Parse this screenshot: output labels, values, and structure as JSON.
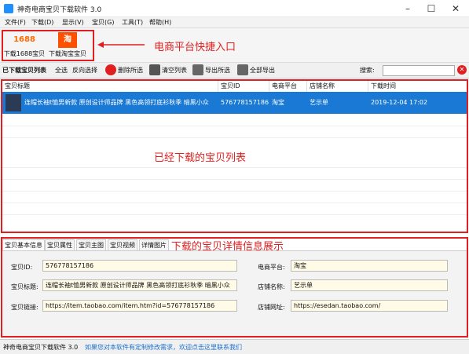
{
  "window": {
    "title": "神奇电商宝贝下载软件 3.0"
  },
  "menu": [
    "文件(F)",
    "下载(D)",
    "显示(V)",
    "宝贝(G)",
    "工具(T)",
    "帮助(H)"
  ],
  "platforms": [
    {
      "logo": "1688",
      "label": "下载1688宝贝",
      "color": "#ff6a00"
    },
    {
      "logo": "淘",
      "label": "下载淘宝宝贝",
      "color": "#ff5000"
    }
  ],
  "annotations": {
    "platform": "电商平台快捷入口",
    "list": "已经下载的宝贝列表",
    "detail": "下载的宝贝详情信息展示"
  },
  "toolbar": {
    "list_label": "已下载宝贝列表",
    "select_all": "全选",
    "invert": "反向选择",
    "delete_selected": "删除所选",
    "clear_list": "清空列表",
    "export_selected": "导出所选",
    "export_all": "全部导出",
    "search_label": "搜索:",
    "search_value": ""
  },
  "table": {
    "columns": [
      "宝贝标题",
      "宝贝ID",
      "电商平台",
      "店铺名称",
      "下载时间"
    ],
    "rows": [
      {
        "title": "连帽长袖t恤男新款 原创设计师品牌 黑色高领打底衫秋季 暗黑小众",
        "id": "576778157186",
        "platform": "淘宝",
        "shop": "艺示单",
        "time": "2019-12-04 17:02"
      }
    ]
  },
  "tabs": [
    "宝贝基本信息",
    "宝贝属性",
    "宝贝主图",
    "宝贝视频",
    "详情图片"
  ],
  "detail": {
    "id_label": "宝贝ID:",
    "id": "576778157186",
    "title_label": "宝贝标题:",
    "title": "连帽长袖t恤男新款 原创设计师品牌 黑色高领打底衫秋季 暗黑小众",
    "link_label": "宝贝链接:",
    "link": "https://item.taobao.com/item.htm?id=576778157186",
    "platform_label": "电商平台:",
    "platform": "淘宝",
    "shop_label": "店铺名称:",
    "shop": "艺示单",
    "shop_url_label": "店铺网址:",
    "shop_url": "https://esedan.taobao.com/"
  },
  "status": {
    "app": "神奇电商宝贝下载软件 3.0",
    "link": "如果您对本软件有定制修改需求，欢迎点击这里联系我们"
  }
}
